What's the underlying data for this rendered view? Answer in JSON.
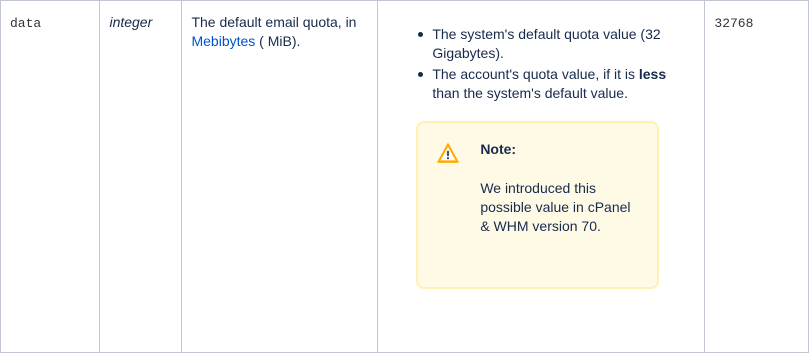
{
  "row": {
    "name": "data",
    "type": "integer",
    "description": {
      "before": "The default email quota, in ",
      "link": "Mebibytes",
      "after": " ( MiB)."
    },
    "values": {
      "item1": "The system's default quota value (32 Gigabytes).",
      "item2_before": "The account's quota value, if it is ",
      "item2_bold": "less",
      "item2_after": " than the system's default value."
    },
    "note": {
      "icon": "warning-icon",
      "title": "Note:",
      "body": "We introduced this possible value in cPanel & WHM version 70."
    },
    "example": "32768"
  },
  "colors": {
    "link": "#0052cc",
    "note_background": "#fffae6",
    "note_border": "#fff0b3",
    "warning_icon": "#ffab00",
    "table_border": "#c1c7d0"
  }
}
